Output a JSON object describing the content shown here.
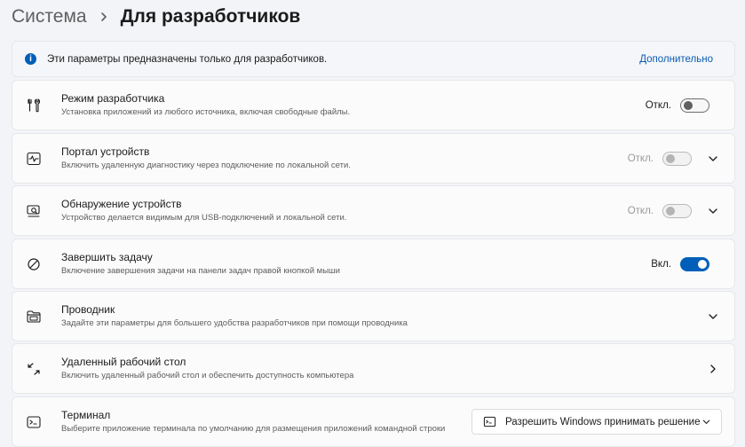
{
  "breadcrumb": {
    "parent": "Система",
    "current": "Для разработчиков"
  },
  "info_banner": {
    "text": "Эти параметры предназначены только для разработчиков.",
    "link": "Дополнительно"
  },
  "settings": [
    {
      "title": "Режим разработчика",
      "description": "Установка приложений из любого источника, включая свободные файлы.",
      "state": "Откл.",
      "icon": "tools-icon"
    },
    {
      "title": "Портал устройств",
      "description": "Включить удаленную диагностику через подключение по локальной сети.",
      "state": "Откл.",
      "icon": "device-portal-icon"
    },
    {
      "title": "Обнаружение устройств",
      "description": "Устройство делается видимым для USB-подключений и локальной сети.",
      "state": "Откл.",
      "icon": "device-discovery-icon"
    },
    {
      "title": "Завершить задачу",
      "description": "Включение завершения задачи на панели задач правой кнопкой мыши",
      "state": "Вкл.",
      "icon": "end-task-icon"
    },
    {
      "title": "Проводник",
      "description": "Задайте эти параметры для большего удобства разработчиков при помощи проводника",
      "icon": "folder-icon"
    },
    {
      "title": "Удаленный рабочий стол",
      "description": "Включить удаленный рабочий стол и обеспечить доступность компьютера",
      "icon": "remote-desktop-icon"
    },
    {
      "title": "Терминал",
      "description": "Выберите приложение терминала по умолчанию для размещения приложений командной строки",
      "select_value": "Разрешить Windows принимать решение",
      "icon": "terminal-icon"
    }
  ],
  "colors": {
    "accent": "#005fb8",
    "link": "#0a5bb4"
  }
}
